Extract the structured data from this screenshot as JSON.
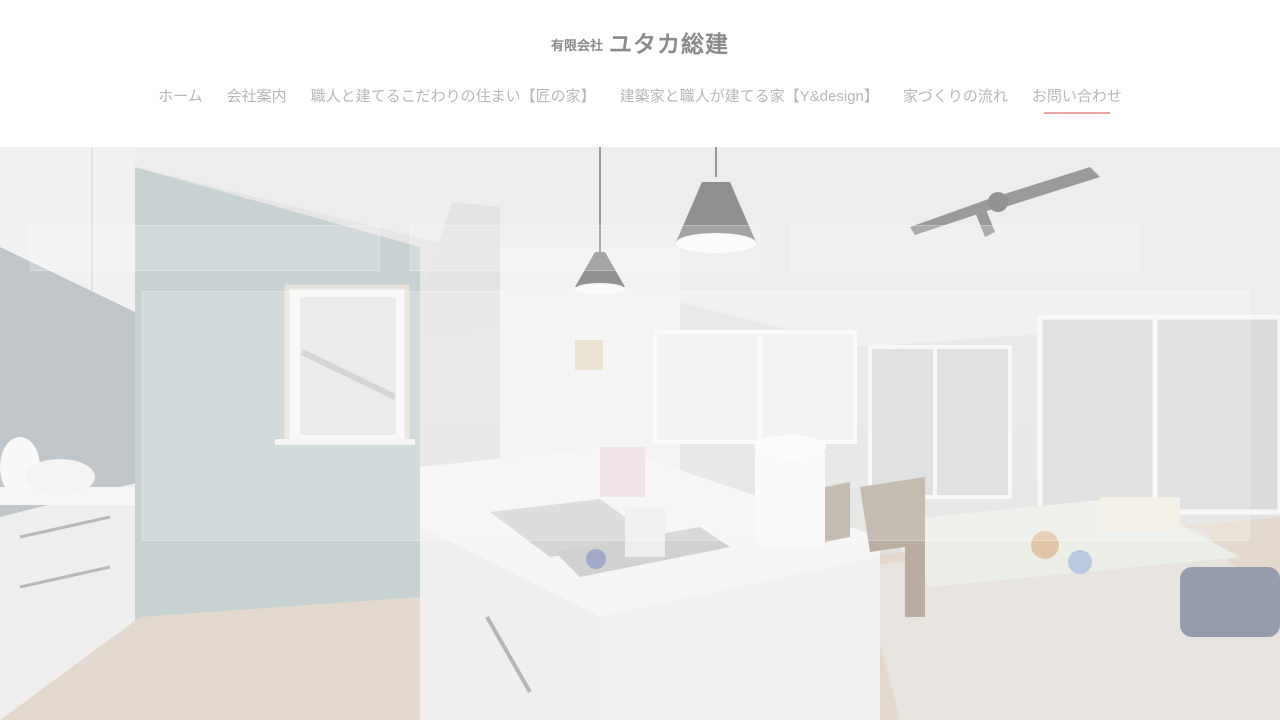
{
  "header": {
    "logo_prefix": "有限会社",
    "logo_name": "ユタカ総建"
  },
  "nav": {
    "items": [
      {
        "label": "ホーム"
      },
      {
        "label": "会社案内"
      },
      {
        "label": "職人と建てるこだわりの住まい【匠の家】"
      },
      {
        "label": "建築家と職人が建てる家【Y&design】"
      },
      {
        "label": "家づくりの流れ"
      },
      {
        "label": "お問い合わせ"
      }
    ],
    "active_index": 5
  },
  "colors": {
    "nav_text": "#b8b8b8",
    "logo_text": "#8a8a8a",
    "active_underline": "#e9a2a2"
  },
  "hero": {
    "image_name": "kitchen-living-room-photo"
  }
}
